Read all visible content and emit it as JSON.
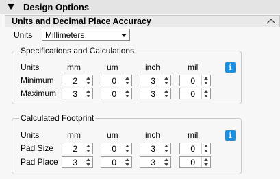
{
  "header": {
    "title": "Design Options"
  },
  "section": {
    "title": "Units and Decimal Place Accuracy"
  },
  "units": {
    "label": "Units",
    "selected": "Millimeters"
  },
  "specs": {
    "legend": "Specifications and Calculations",
    "col_units": "Units",
    "columns": [
      "mm",
      "um",
      "inch",
      "mil"
    ],
    "rows": [
      {
        "label": "Minimum",
        "values": [
          "2",
          "0",
          "3",
          "0"
        ]
      },
      {
        "label": "Maximum",
        "values": [
          "3",
          "0",
          "3",
          "0"
        ]
      }
    ],
    "info_glyph": "i"
  },
  "footprint": {
    "legend": "Calculated Footprint",
    "col_units": "Units",
    "columns": [
      "mm",
      "um",
      "inch",
      "mil"
    ],
    "rows": [
      {
        "label": "Pad Size",
        "values": [
          "2",
          "0",
          "3",
          "0"
        ]
      },
      {
        "label": "Pad Place",
        "values": [
          "3",
          "0",
          "3",
          "0"
        ]
      }
    ],
    "info_glyph": "i"
  },
  "colors": {
    "info": "#1b8fe0"
  }
}
